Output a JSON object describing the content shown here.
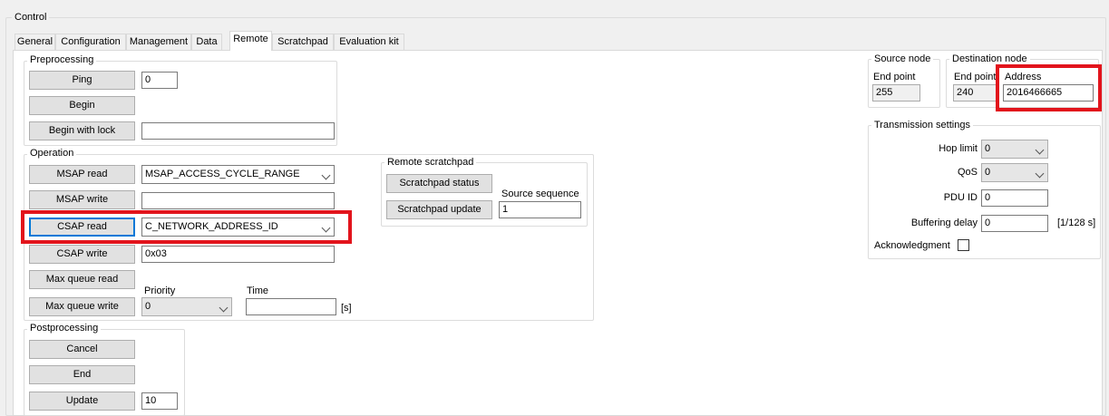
{
  "control": {
    "title": "Control"
  },
  "tabs": [
    {
      "label": "General"
    },
    {
      "label": "Configuration"
    },
    {
      "label": "Management"
    },
    {
      "label": "Data"
    },
    {
      "label": "Remote"
    },
    {
      "label": "Scratchpad"
    },
    {
      "label": "Evaluation kit"
    }
  ],
  "preprocessing": {
    "title": "Preprocessing",
    "ping_label": "Ping",
    "ping_value": "0",
    "begin_label": "Begin",
    "begin_with_lock_label": "Begin with lock",
    "begin_with_lock_value": ""
  },
  "operation": {
    "title": "Operation",
    "msap_read_label": "MSAP read",
    "msap_read_value": "MSAP_ACCESS_CYCLE_RANGE",
    "msap_write_label": "MSAP write",
    "msap_write_value": "",
    "csap_read_label": "CSAP read",
    "csap_read_value": "C_NETWORK_ADDRESS_ID",
    "csap_write_label": "CSAP write",
    "csap_write_value": "0x03",
    "max_queue_read_label": "Max queue read",
    "max_queue_write_label": "Max queue write",
    "priority_label": "Priority",
    "priority_value": "0",
    "time_label": "Time",
    "time_value": "",
    "time_unit": "[s]"
  },
  "remote_scratchpad": {
    "title": "Remote scratchpad",
    "status_label": "Scratchpad status",
    "update_label": "Scratchpad update",
    "source_sequence_label": "Source sequence",
    "source_sequence_value": "1"
  },
  "postprocessing": {
    "title": "Postprocessing",
    "cancel_label": "Cancel",
    "end_label": "End",
    "update_label": "Update",
    "update_value": "10"
  },
  "source_node": {
    "title": "Source node",
    "endpoint_label": "End point",
    "endpoint_value": "255"
  },
  "destination_node": {
    "title": "Destination node",
    "endpoint_label": "End point",
    "endpoint_value": "240",
    "address_label": "Address",
    "address_value": "2016466665"
  },
  "transmission": {
    "title": "Transmission settings",
    "hop_limit_label": "Hop limit",
    "hop_limit_value": "0",
    "qos_label": "QoS",
    "qos_value": "0",
    "pdu_id_label": "PDU ID",
    "pdu_id_value": "0",
    "buffering_delay_label": "Buffering delay",
    "buffering_delay_value": "0",
    "buffering_delay_unit": "[1/128 s]",
    "acknowledgment_label": "Acknowledgment"
  },
  "colors": {
    "highlight": "#e2141c",
    "focus": "#0078d7"
  }
}
